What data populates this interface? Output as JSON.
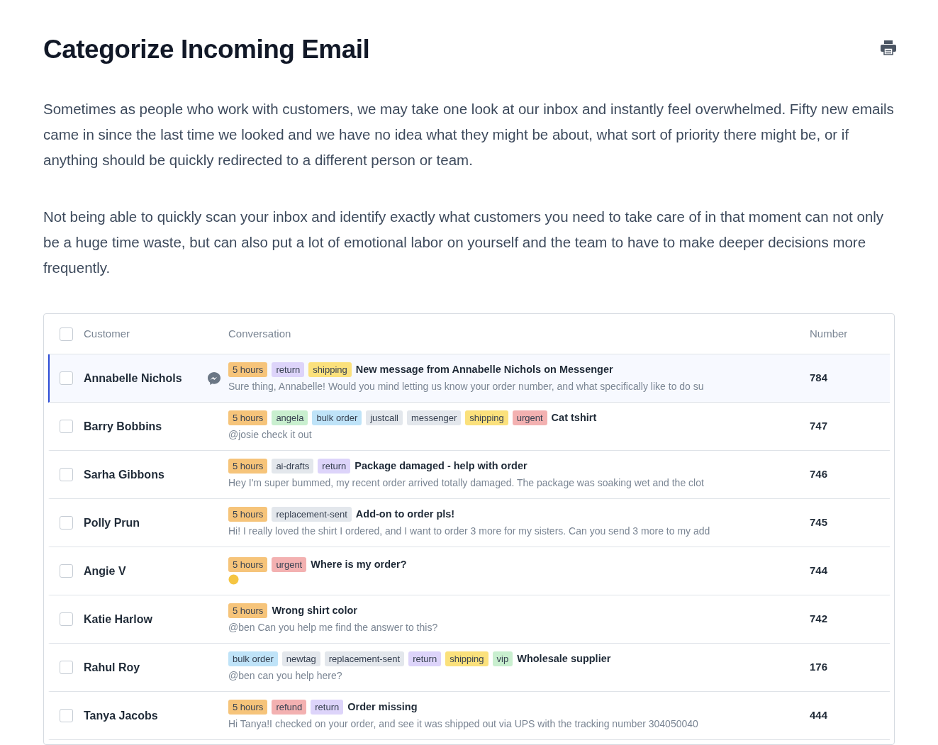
{
  "title": "Categorize Incoming Email",
  "paragraphs": [
    "Sometimes as people who work with customers, we may take one look at our inbox and instantly feel overwhelmed. Fifty new emails came in since the last time we looked and we have no idea what they might be about, what sort of priority there might be, or if anything should be quickly redirected to a different person or team.",
    "Not being able to quickly scan your inbox and identify exactly what customers you need to take care of in that moment can not only be a huge time waste, but can also put a lot of emotional labor on yourself and the team to have to make deeper decisions more frequently."
  ],
  "table": {
    "columns": [
      "Customer",
      "Conversation",
      "Number"
    ],
    "all_checked": false,
    "rows": [
      {
        "customer": "Annabelle Nichols",
        "selected": true,
        "checked": false,
        "messenger": true,
        "tags": [
          {
            "label": "5 hours",
            "color": "#f6c47a"
          },
          {
            "label": "return",
            "color": "#ddd4fa"
          },
          {
            "label": "shipping",
            "color": "#fbe17c"
          }
        ],
        "subject": "New message from Annabelle Nichols on Messenger",
        "preview": {
          "kind": "text",
          "text": "Sure thing, Annabelle! Would you mind letting us know your order number, and what specifically like to do su"
        },
        "number": "784"
      },
      {
        "customer": "Barry Bobbins",
        "selected": false,
        "checked": false,
        "messenger": false,
        "tags": [
          {
            "label": "5 hours",
            "color": "#f6c47a"
          },
          {
            "label": "angela",
            "color": "#c9efcf"
          },
          {
            "label": "bulk order",
            "color": "#bfe3f8"
          },
          {
            "label": "justcall",
            "color": "#e3e7ec"
          },
          {
            "label": "messenger",
            "color": "#e3e7ec"
          },
          {
            "label": "shipping",
            "color": "#fbe17c"
          },
          {
            "label": "urgent",
            "color": "#f3b1b1"
          }
        ],
        "subject": "Cat tshirt",
        "preview": {
          "kind": "text",
          "text": "@josie check it out"
        },
        "number": "747"
      },
      {
        "customer": "Sarha Gibbons",
        "selected": false,
        "checked": false,
        "messenger": false,
        "tags": [
          {
            "label": "5 hours",
            "color": "#f6c47a"
          },
          {
            "label": "ai-drafts",
            "color": "#e3e7ec"
          },
          {
            "label": "return",
            "color": "#ddd4fa"
          }
        ],
        "subject": "Package damaged - help with order",
        "preview": {
          "kind": "text",
          "text": "Hey I'm super bummed, my recent order arrived totally damaged. The package was soaking wet and the clot"
        },
        "number": "746"
      },
      {
        "customer": "Polly Prun",
        "selected": false,
        "checked": false,
        "messenger": false,
        "tags": [
          {
            "label": "5 hours",
            "color": "#f6c47a"
          },
          {
            "label": "replacement-sent",
            "color": "#e3e7ec"
          }
        ],
        "subject": "Add-on to order pls!",
        "preview": {
          "kind": "text",
          "text": "Hi! I really loved the shirt I ordered, and I want to order 3 more for my sisters. Can you send 3 more to my add"
        },
        "number": "745"
      },
      {
        "customer": "Angie V",
        "selected": false,
        "checked": false,
        "messenger": false,
        "tags": [
          {
            "label": "5 hours",
            "color": "#f6c47a"
          },
          {
            "label": "urgent",
            "color": "#f3b1b1"
          }
        ],
        "subject": "Where is my order?",
        "preview": {
          "kind": "emoji"
        },
        "number": "744"
      },
      {
        "customer": "Katie Harlow",
        "selected": false,
        "checked": false,
        "messenger": false,
        "tags": [
          {
            "label": "5 hours",
            "color": "#f6c47a"
          }
        ],
        "subject": "Wrong shirt color",
        "preview": {
          "kind": "text",
          "text": "@ben Can you help me find the answer to this?"
        },
        "number": "742"
      },
      {
        "customer": "Rahul Roy",
        "selected": false,
        "checked": false,
        "messenger": false,
        "tags": [
          {
            "label": "bulk order",
            "color": "#bfe3f8"
          },
          {
            "label": "newtag",
            "color": "#e3e7ec"
          },
          {
            "label": "replacement-sent",
            "color": "#e3e7ec"
          },
          {
            "label": "return",
            "color": "#ddd4fa"
          },
          {
            "label": "shipping",
            "color": "#fbe17c"
          },
          {
            "label": "vip",
            "color": "#c9efcf"
          }
        ],
        "subject": "Wholesale supplier",
        "preview": {
          "kind": "text",
          "text": "@ben can you help here?"
        },
        "number": "176"
      },
      {
        "customer": "Tanya Jacobs",
        "selected": false,
        "checked": false,
        "messenger": false,
        "tags": [
          {
            "label": "5 hours",
            "color": "#f6c47a"
          },
          {
            "label": "refund",
            "color": "#f3b1b1"
          },
          {
            "label": "return",
            "color": "#ddd4fa"
          }
        ],
        "subject": "Order missing",
        "preview": {
          "kind": "text",
          "text": "Hi Tanya!I checked on your order, and see it was shipped out via UPS with the tracking number 304050040"
        },
        "number": "444"
      }
    ]
  }
}
